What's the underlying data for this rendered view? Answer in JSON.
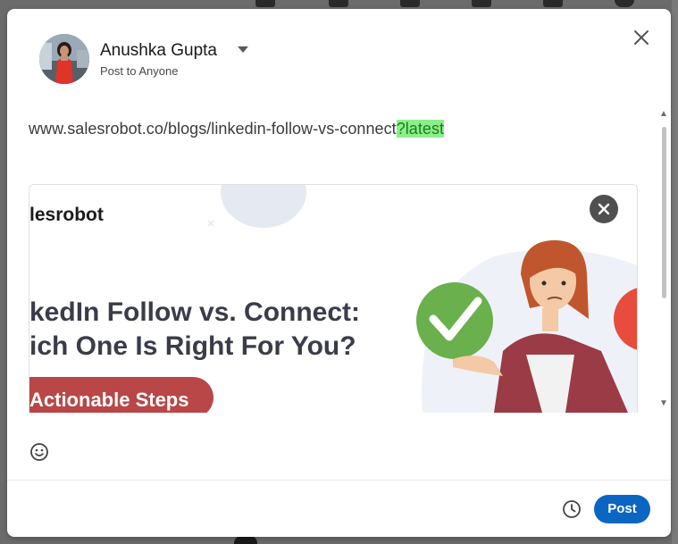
{
  "composer": {
    "author_name": "Anushka Gupta",
    "audience": "Post to Anyone",
    "avatar_icon": "profile-photo",
    "close_icon": "close-icon",
    "post_text_main": "www.salesrobot.co/blogs/linkedin-follow-vs-connect",
    "post_text_highlight": "?latest",
    "highlight_color": "#8bf08b"
  },
  "link_preview": {
    "brand": "lesrobot",
    "headline_line1": "kedIn Follow vs. Connect:",
    "headline_line2": "ich One Is Right For You?",
    "pill_text": "Actionable Steps",
    "remove_icon": "close-icon"
  },
  "toolbar": {
    "emoji_icon": "smiley-icon",
    "schedule_icon": "clock-icon",
    "post_label": "Post",
    "post_color": "#0a66c2"
  }
}
